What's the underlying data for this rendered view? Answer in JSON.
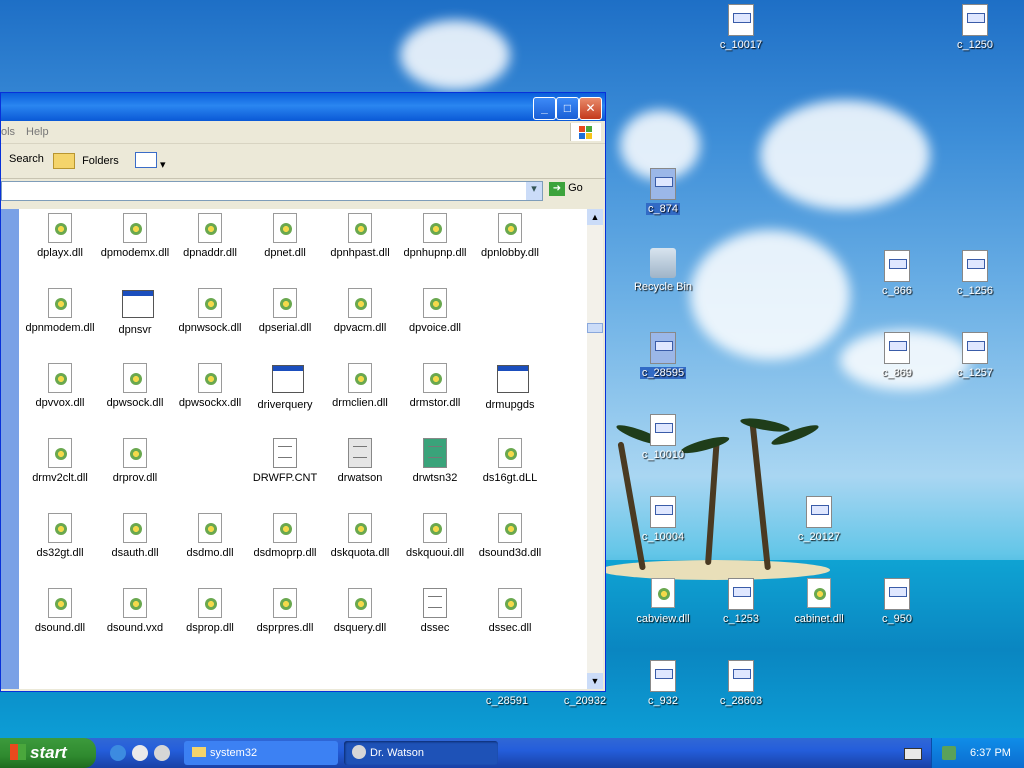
{
  "desktop": {
    "icons": [
      {
        "label": "c_10017"
      },
      {
        "label": "c_1250"
      },
      {
        "label": "c_874",
        "selected": true
      },
      {
        "label": "Recycle Bin"
      },
      {
        "label": "c_866"
      },
      {
        "label": "c_1256"
      },
      {
        "label": "c_28595",
        "selected": true
      },
      {
        "label": "c_869"
      },
      {
        "label": "c_1257"
      },
      {
        "label": "c_10010"
      },
      {
        "label": "c_10004"
      },
      {
        "label": "c_20127"
      },
      {
        "label": "cabview.dll"
      },
      {
        "label": "c_1253"
      },
      {
        "label": "cabinet.dll"
      },
      {
        "label": "c_950"
      },
      {
        "label": "c_28591"
      },
      {
        "label": "c_20932"
      },
      {
        "label": "c_932"
      },
      {
        "label": "c_28603"
      }
    ]
  },
  "window": {
    "menu": {
      "tools_partial": "ols",
      "help": "Help"
    },
    "toolbar": {
      "search": "Search",
      "folders": "Folders"
    },
    "address": {
      "go": "Go"
    },
    "files": [
      [
        "dplayx.dll",
        "dpmodemx.dll",
        "dpnaddr.dll",
        "dpnet.dll",
        "dpnhpast.dll",
        "dpnhupnp.dll",
        "dpnlobby.dll"
      ],
      [
        "dpnmodem.dll",
        "dpnsvr",
        "dpnwsock.dll",
        "dpserial.dll",
        "dpvacm.dll",
        "dpvoice.dll",
        ""
      ],
      [
        "dpvvox.dll",
        "dpwsock.dll",
        "dpwsockx.dll",
        "driverquery",
        "drmclien.dll",
        "drmstor.dll",
        "drmupgds"
      ],
      [
        "drmv2clt.dll",
        "drprov.dll",
        "",
        "DRWFP.CNT",
        "drwatson",
        "drwtsn32",
        "ds16gt.dLL"
      ],
      [
        "ds32gt.dll",
        "dsauth.dll",
        "dsdmo.dll",
        "dsdmoprp.dll",
        "dskquota.dll",
        "dskquoui.dll",
        "dsound3d.dll"
      ],
      [
        "dsound.dll",
        "dsound.vxd",
        "dsprop.dll",
        "dsprpres.dll",
        "dsquery.dll",
        "dssec",
        "dssec.dll"
      ]
    ]
  },
  "taskbar": {
    "start_label": "start",
    "tasks": [
      {
        "label": "system32"
      },
      {
        "label": "Dr. Watson"
      }
    ],
    "clock": "6:37 PM"
  }
}
